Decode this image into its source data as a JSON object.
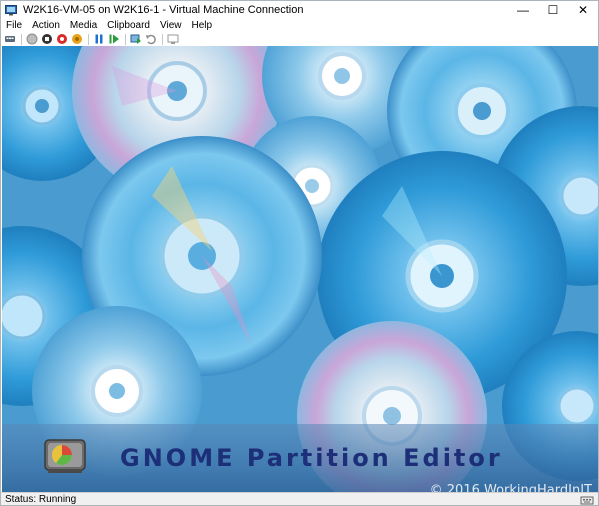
{
  "window": {
    "title": "W2K16-VM-05 on W2K16-1 - Virtual Machine Connection",
    "controls": {
      "minimize": "—",
      "maximize": "☐",
      "close": "✕"
    }
  },
  "menu": {
    "items": [
      "File",
      "Action",
      "Media",
      "Clipboard",
      "View",
      "Help"
    ]
  },
  "toolbar": {
    "buttons": [
      {
        "name": "ctrl-alt-del-icon"
      },
      {
        "name": "start-icon"
      },
      {
        "name": "turn-off-icon"
      },
      {
        "name": "shut-down-icon"
      },
      {
        "name": "save-icon"
      },
      {
        "name": "pause-icon"
      },
      {
        "name": "resume-icon"
      },
      {
        "name": "checkpoint-icon"
      },
      {
        "name": "revert-icon"
      },
      {
        "name": "enhanced-session-icon"
      }
    ]
  },
  "vm_screen": {
    "banner_text": "GNOME Partition Editor",
    "watermark": "© 2016 WorkingHardInIT",
    "colors": {
      "banner_text": "#1c2f78",
      "background": "#3e8fc6"
    }
  },
  "status": {
    "text": "Status: Running"
  }
}
